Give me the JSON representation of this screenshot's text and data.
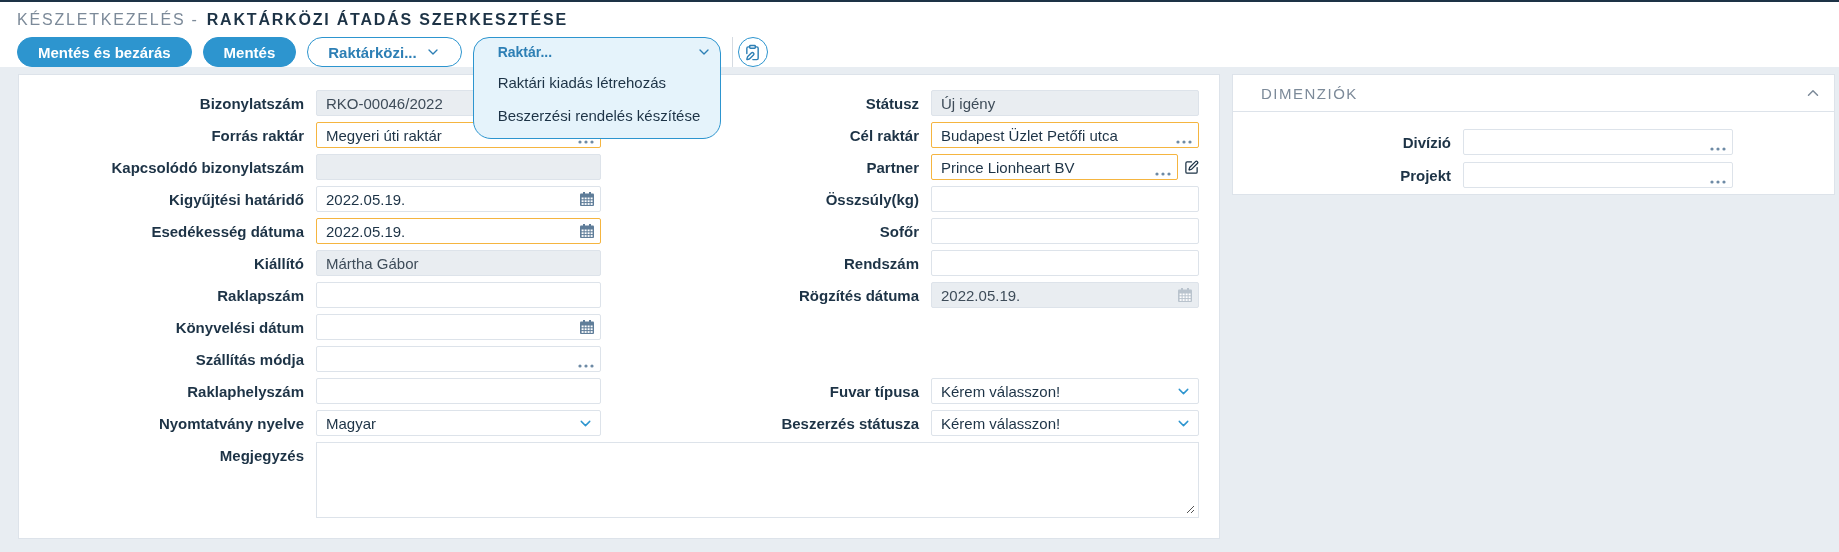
{
  "breadcrumb": {
    "module": "KÉSZLETKEZELÉS -",
    "page": "RAKTÁRKÖZI ÁTADÁS SZERKESZTÉSE"
  },
  "toolbar": {
    "buttons": [
      {
        "label": "Mentés és bezárás",
        "kind": "primary"
      },
      {
        "label": "Mentés",
        "kind": "primary"
      },
      {
        "label": "Raktárközi...",
        "kind": "menu"
      }
    ],
    "dropdown": {
      "label": "Raktár...",
      "expanded": true,
      "items": [
        {
          "label": "Raktári kiadás létrehozás"
        },
        {
          "label": "Beszerzési rendelés készítése"
        }
      ]
    }
  },
  "form": {
    "rows": [
      {
        "left": {
          "label": "Bizonylatszám",
          "kind": "text",
          "value": "RKO-00046/2022",
          "disabled": true
        },
        "right": {
          "label": "Státusz",
          "kind": "text",
          "value": "Új igény",
          "disabled": true
        }
      },
      {
        "left": {
          "label": "Forrás raktár",
          "kind": "lookup",
          "value": "Megyeri úti raktár",
          "required": true
        },
        "right": {
          "label": "Cél raktár",
          "kind": "lookup",
          "value": "Budapest Üzlet Petőfi utca",
          "required": true
        }
      },
      {
        "left": {
          "label": "Kapcsolódó bizonylatszám",
          "kind": "text",
          "disabled": true
        },
        "right": {
          "label": "Partner",
          "kind": "lookup",
          "value": "Prince Lionheart BV",
          "required": true,
          "edit": true
        }
      },
      {
        "left": {
          "label": "Kigyűjtési határidő",
          "kind": "date",
          "value": "2022.05.19."
        },
        "right": {
          "label": "Összsúly(kg)",
          "kind": "text"
        }
      },
      {
        "left": {
          "label": "Esedékesség dátuma",
          "kind": "date",
          "value": "2022.05.19.",
          "required": true
        },
        "right": {
          "label": "Sofőr",
          "kind": "text"
        }
      },
      {
        "left": {
          "label": "Kiállító",
          "kind": "text",
          "value": "Mártha Gábor",
          "disabled": true
        },
        "right": {
          "label": "Rendszám",
          "kind": "text"
        }
      },
      {
        "left": {
          "label": "Raklapszám",
          "kind": "text"
        },
        "right": {
          "label": "Rögzítés dátuma",
          "kind": "date",
          "value": "2022.05.19.",
          "disabled": true
        }
      },
      {
        "left": {
          "label": "Könyvelési dátum",
          "kind": "date"
        }
      },
      {
        "left": {
          "label": "Szállítás módja",
          "kind": "lookup"
        }
      },
      {
        "left": {
          "label": "Raklaphelyszám",
          "kind": "text"
        },
        "right": {
          "label": "Fuvar típusa",
          "kind": "select",
          "value": "Kérem válasszon!"
        }
      },
      {
        "left": {
          "label": "Nyomtatvány nyelve",
          "kind": "select",
          "value": "Magyar"
        },
        "right": {
          "label": "Beszerzés státusza",
          "kind": "select",
          "value": "Kérem válasszon!"
        }
      },
      {
        "left": {
          "label": "Megjegyzés",
          "kind": "textarea"
        }
      }
    ]
  },
  "dimensions": {
    "title": "DIMENZIÓK",
    "expanded": true,
    "fields": [
      {
        "label": "Divízió",
        "kind": "lookup"
      },
      {
        "label": "Projekt",
        "kind": "lookup"
      }
    ]
  }
}
